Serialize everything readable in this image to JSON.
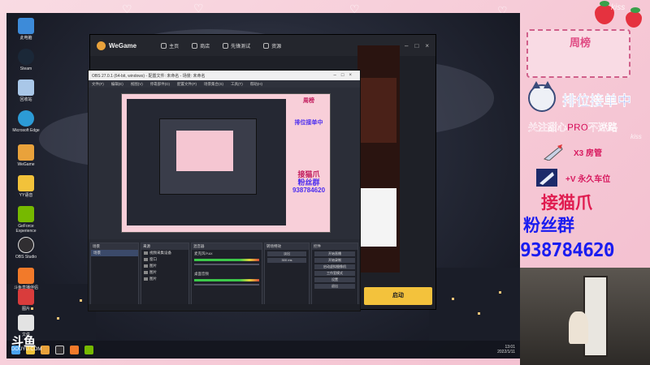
{
  "stream_overlay": {
    "rank_title": "周榜",
    "status_line": "排位接单中",
    "follow_line": "关注甜心PRO不迷路",
    "rank_x3": "X3 房管",
    "rank_v": "+V 永久车位",
    "catch_cat": "接猫爪",
    "fan_group": "粉丝群",
    "qq_number": "938784620",
    "kiss_label": "kiss"
  },
  "desktop_icons": [
    {
      "label": "此电脑",
      "icon": "computer-icon",
      "color": "#3d8bd9"
    },
    {
      "label": "Steam",
      "icon": "steam-icon",
      "color": "#1b2838"
    },
    {
      "label": "回收站",
      "icon": "recycle-bin-icon",
      "color": "#a9c7e8"
    },
    {
      "label": "Microsoft Edge",
      "icon": "edge-icon",
      "color": "#2c9bd6"
    },
    {
      "label": "WeGame",
      "icon": "wegame-icon",
      "color": "#e9a23b"
    },
    {
      "label": "YY语音",
      "icon": "yy-icon",
      "color": "#f2c23a"
    },
    {
      "label": "GeForce Experience",
      "icon": "nvidia-icon",
      "color": "#76b900"
    },
    {
      "label": "OBS Studio",
      "icon": "obs-icon",
      "color": "#302e31"
    },
    {
      "label": "斗鱼直播伴侣",
      "icon": "douyu-icon",
      "color": "#f27a2a"
    },
    {
      "label": "图片",
      "icon": "pictures-icon",
      "color": "#d93c3c"
    },
    {
      "label": "文件",
      "icon": "file-icon",
      "color": "#e3e3e3"
    }
  ],
  "wegame": {
    "name": "WeGame",
    "nav": [
      "主页",
      "商店",
      "先锋测试",
      "资源"
    ],
    "launch_label": "启动"
  },
  "obs": {
    "title": "OBS 27.0.1 (64-bit, windows) - 配置文件: 未命名 - 场景: 未命名",
    "menu": [
      "文件(F)",
      "编辑(E)",
      "视图(V)",
      "停靠部件(D)",
      "配置文件(P)",
      "场景集合(S)",
      "工具(T)",
      "帮助(H)"
    ],
    "docks": {
      "scenes": "场景",
      "sources": "来源",
      "mixer": "混音器",
      "transitions": "转场特效",
      "controls": "控件"
    },
    "scene_name": "场景",
    "sources_list": [
      "视频采集设备",
      "窗口",
      "图片",
      "图片",
      "图片"
    ],
    "mixer_tracks": [
      "麦克风/Aux",
      "桌面音频"
    ],
    "transition": "淡出",
    "duration": "300 ms",
    "control_buttons": [
      "开始直播",
      "开始录制",
      "启动虚拟摄像机",
      "工作室模式",
      "设置",
      "退出"
    ],
    "preview_overlay": {
      "title": "周榜",
      "line1": "排位接单中",
      "line2": "接猫爪",
      "line3": "粉丝群",
      "line4": "938784620"
    }
  },
  "taskbar": {
    "time": "13:01",
    "date": "2022/1/11"
  },
  "douyu": {
    "logo": "斗鱼",
    "url": "DOUYU.COM"
  }
}
